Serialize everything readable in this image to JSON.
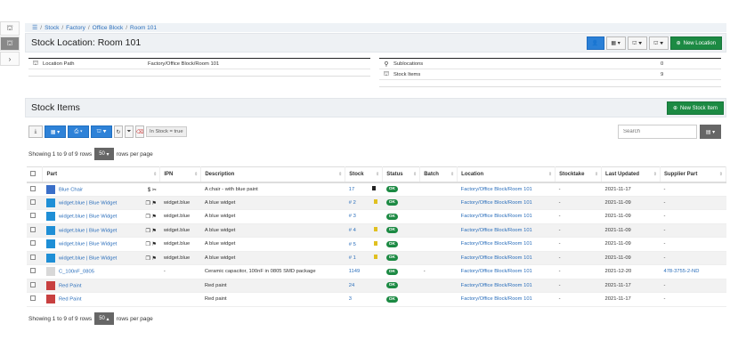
{
  "breadcrumb": [
    "Stock",
    "Factory",
    "Office Block",
    "Room 101"
  ],
  "location": {
    "title": "Stock Location: Room 101",
    "new_location_label": "New Location",
    "path_label": "Location Path",
    "path_value": "Factory/Office Block/Room 101",
    "sublocations_label": "Sublocations",
    "sublocations_value": "0",
    "stock_items_label": "Stock Items",
    "stock_items_value": "9"
  },
  "stock": {
    "title": "Stock Items",
    "new_item_label": "New Stock Item",
    "filter_chip": "In Stock = true",
    "search_placeholder": "Search",
    "rows_info_top": "Showing 1 to 9 of 9 rows",
    "rows_info_bottom": "Showing 1 to 9 of 9 rows",
    "page_size": "50",
    "per_page_label": "rows per page",
    "columns": [
      "Part",
      "IPN",
      "Description",
      "Stock",
      "Status",
      "Batch",
      "Location",
      "Stocktake",
      "Last Updated",
      "Supplier Part"
    ],
    "rows": [
      {
        "part": "Blue Chair",
        "icons": "$ ✂",
        "ipn": "",
        "description": "A chair - with blue paint",
        "stock": "17",
        "status": "OK",
        "batch": "",
        "location": "Factory/Office Block/Room 101",
        "stocktake": "-",
        "updated": "2021-11-17",
        "supplier": "-",
        "thumb": "#3a6fc9",
        "mark": "#222"
      },
      {
        "part": "widget.blue | Blue Widget",
        "icons": "❐ ⚑",
        "ipn": "widget.blue",
        "description": "A blue widget",
        "stock": "# 2",
        "status": "OK",
        "batch": "",
        "location": "Factory/Office Block/Room 101",
        "stocktake": "-",
        "updated": "2021-11-09",
        "supplier": "-",
        "thumb": "#1f8fd6",
        "mark": "#e0c020"
      },
      {
        "part": "widget.blue | Blue Widget",
        "icons": "❐ ⚑",
        "ipn": "widget.blue",
        "description": "A blue widget",
        "stock": "# 3",
        "status": "OK",
        "batch": "",
        "location": "Factory/Office Block/Room 101",
        "stocktake": "-",
        "updated": "2021-11-09",
        "supplier": "-",
        "thumb": "#1f8fd6",
        "mark": ""
      },
      {
        "part": "widget.blue | Blue Widget",
        "icons": "❐ ⚑",
        "ipn": "widget.blue",
        "description": "A blue widget",
        "stock": "# 4",
        "status": "OK",
        "batch": "",
        "location": "Factory/Office Block/Room 101",
        "stocktake": "-",
        "updated": "2021-11-09",
        "supplier": "-",
        "thumb": "#1f8fd6",
        "mark": "#e0c020"
      },
      {
        "part": "widget.blue | Blue Widget",
        "icons": "❐ ⚑",
        "ipn": "widget.blue",
        "description": "A blue widget",
        "stock": "# 5",
        "status": "OK",
        "batch": "",
        "location": "Factory/Office Block/Room 101",
        "stocktake": "-",
        "updated": "2021-11-09",
        "supplier": "-",
        "thumb": "#1f8fd6",
        "mark": "#e0c020"
      },
      {
        "part": "widget.blue | Blue Widget",
        "icons": "❐ ⚑",
        "ipn": "widget.blue",
        "description": "A blue widget",
        "stock": "# 1",
        "status": "OK",
        "batch": "",
        "location": "Factory/Office Block/Room 101",
        "stocktake": "-",
        "updated": "2021-11-09",
        "supplier": "-",
        "thumb": "#1f8fd6",
        "mark": "#e0c020"
      },
      {
        "part": "C_100nF_0805",
        "icons": "",
        "ipn": "-",
        "description": "Ceramic capacitor, 100nF in 0805 SMD package",
        "stock": "1149",
        "status": "OK",
        "batch": "-",
        "location": "Factory/Office Block/Room 101",
        "stocktake": "-",
        "updated": "2021-12-20",
        "supplier": "478-3755-2-ND",
        "thumb": "#d8d8d8",
        "mark": ""
      },
      {
        "part": "Red Paint",
        "icons": "",
        "ipn": "",
        "description": "Red paint",
        "stock": "24",
        "status": "OK",
        "batch": "",
        "location": "Factory/Office Block/Room 101",
        "stocktake": "-",
        "updated": "2021-11-17",
        "supplier": "-",
        "thumb": "#c84040",
        "mark": ""
      },
      {
        "part": "Red Paint",
        "icons": "",
        "ipn": "",
        "description": "Red paint",
        "stock": "3",
        "status": "OK",
        "batch": "",
        "location": "Factory/Office Block/Room 101",
        "stocktake": "-",
        "updated": "2021-11-17",
        "supplier": "-",
        "thumb": "#c84040",
        "mark": ""
      }
    ]
  }
}
